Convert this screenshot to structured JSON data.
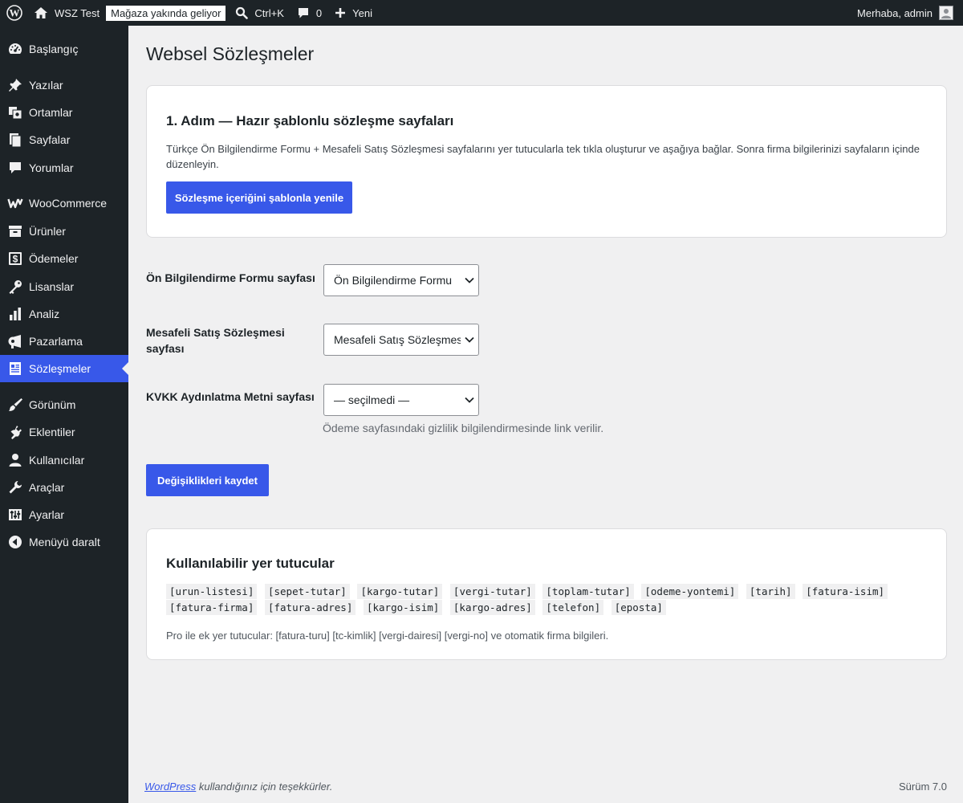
{
  "adminbar": {
    "site_name": "WSZ Test",
    "store_badge": "Mağaza yakında geliyor",
    "search_shortcut": "Ctrl+K",
    "comments_count": "0",
    "new_label": "Yeni",
    "howdy": "Merhaba, admin"
  },
  "sidebar": {
    "items": [
      {
        "label": "Başlangıç",
        "icon": "dashboard-icon"
      },
      {
        "label": "Yazılar",
        "icon": "pin-icon"
      },
      {
        "label": "Ortamlar",
        "icon": "media-icon"
      },
      {
        "label": "Sayfalar",
        "icon": "pages-icon"
      },
      {
        "label": "Yorumlar",
        "icon": "comment-icon"
      },
      {
        "label": "WooCommerce",
        "icon": "woocommerce-icon"
      },
      {
        "label": "Ürünler",
        "icon": "archive-icon"
      },
      {
        "label": "Ödemeler",
        "icon": "payments-icon"
      },
      {
        "label": "Lisanslar",
        "icon": "key-icon"
      },
      {
        "label": "Analiz",
        "icon": "bar-chart-icon"
      },
      {
        "label": "Pazarlama",
        "icon": "megaphone-icon"
      },
      {
        "label": "Sözleşmeler",
        "icon": "document-icon"
      },
      {
        "label": "Görünüm",
        "icon": "brush-icon"
      },
      {
        "label": "Eklentiler",
        "icon": "plugin-icon"
      },
      {
        "label": "Kullanıcılar",
        "icon": "user-icon"
      },
      {
        "label": "Araçlar",
        "icon": "wrench-icon"
      },
      {
        "label": "Ayarlar",
        "icon": "settings-sliders-icon"
      },
      {
        "label": "Menüyü daralt",
        "icon": "collapse-icon"
      }
    ]
  },
  "page": {
    "title": "Websel Sözleşmeler"
  },
  "step_card": {
    "heading": "1. Adım — Hazır şablonlu sözleşme sayfaları",
    "description": "Türkçe Ön Bilgilendirme Formu + Mesafeli Satış Sözleşmesi sayfalarını yer tutucularla tek tıkla oluşturur ve aşağıya bağlar. Sonra firma bilgilerinizi sayfaların içinde düzenleyin.",
    "button_label": "Sözleşme içeriğini şablonla yenile"
  },
  "form": {
    "fields": [
      {
        "label": "Ön Bilgilendirme Formu sayfası",
        "selected": "Ön Bilgilendirme Formu"
      },
      {
        "label": "Mesafeli Satış Sözleşmesi sayfası",
        "selected": "Mesafeli Satış Sözleşmesi"
      },
      {
        "label": "KVKK Aydınlatma Metni sayfası",
        "selected": "— seçilmedi —"
      }
    ],
    "kvkk_description": "Ödeme sayfasındaki gizlilik bilgilendirmesinde link verilir.",
    "save_label": "Değişiklikleri kaydet"
  },
  "placeholders_card": {
    "heading": "Kullanılabilir yer tutucular",
    "codes": [
      "[urun-listesi]",
      "[sepet-tutar]",
      "[kargo-tutar]",
      "[vergi-tutar]",
      "[toplam-tutar]",
      "[odeme-yontemi]",
      "[tarih]",
      "[fatura-isim]",
      "[fatura-firma]",
      "[fatura-adres]",
      "[kargo-isim]",
      "[kargo-adres]",
      "[telefon]",
      "[eposta]"
    ],
    "pro_note": "Pro ile ek yer tutucular: [fatura-turu] [tc-kimlik] [vergi-dairesi] [vergi-no] ve otomatik firma bilgileri."
  },
  "footer": {
    "wordpress_link": "WordPress",
    "thanks_rest": " kullandığınız için teşekkürler.",
    "version": "Sürüm 7.0"
  },
  "colors": {
    "adminbar_bg": "#1d2327",
    "accent": "#3858e9",
    "page_bg": "#f0f0f1"
  }
}
